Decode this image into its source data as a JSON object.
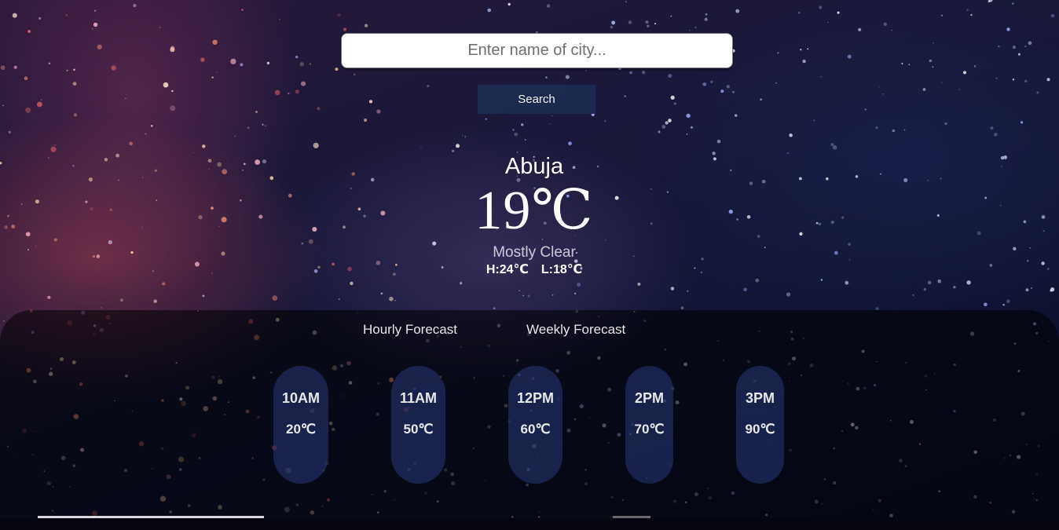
{
  "search": {
    "placeholder": "Enter name of city...",
    "button_label": "Search"
  },
  "current": {
    "city": "Abuja",
    "temperature": "19℃",
    "condition": "Mostly Clear",
    "high": "H:24℃",
    "low": "L:18℃"
  },
  "tabs": {
    "hourly": "Hourly Forecast",
    "weekly": "Weekly Forecast"
  },
  "hourly": [
    {
      "time": "10AM",
      "temp": "20",
      "unit": "℃"
    },
    {
      "time": "11AM",
      "temp": "50",
      "unit": "℃"
    },
    {
      "time": "12PM",
      "temp": "60",
      "unit": "℃"
    },
    {
      "time": "2PM",
      "temp": "70",
      "unit": "℃"
    },
    {
      "time": "3PM",
      "temp": "90",
      "unit": "℃"
    }
  ],
  "colors": {
    "button_bg": "#1c2a52",
    "pill_bg": "rgba(40,55,120,0.55)",
    "panel_bg": "rgba(0,0,0,0.55)"
  }
}
